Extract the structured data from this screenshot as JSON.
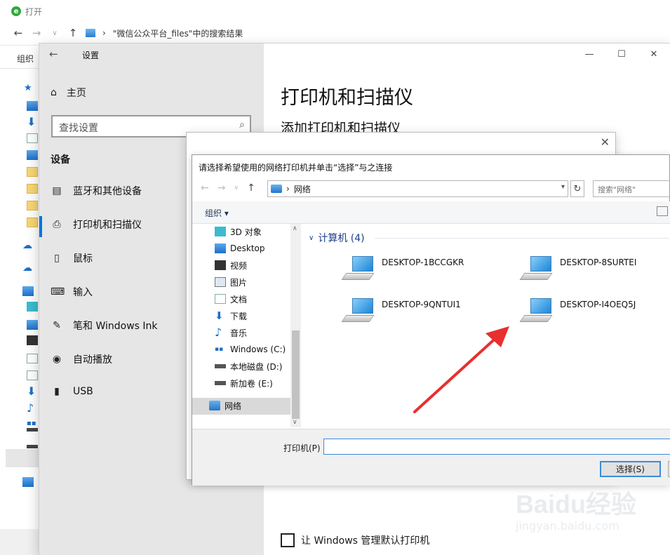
{
  "background_window": {
    "title": "打开",
    "path": "\"微信公众平台_files\"中的搜索结果",
    "ribbon_label": "组织"
  },
  "settings": {
    "window_title": "设置",
    "home_label": "主页",
    "search_placeholder": "查找设置",
    "group_title": "设备",
    "items": [
      {
        "label": "蓝牙和其他设备",
        "icon": "bluetooth-devices-icon"
      },
      {
        "label": "打印机和扫描仪",
        "icon": "printer-icon",
        "selected": true
      },
      {
        "label": "鼠标",
        "icon": "mouse-icon"
      },
      {
        "label": "输入",
        "icon": "keyboard-icon"
      },
      {
        "label": "笔和 Windows Ink",
        "icon": "pen-icon"
      },
      {
        "label": "自动播放",
        "icon": "autoplay-icon"
      },
      {
        "label": "USB",
        "icon": "usb-icon"
      }
    ],
    "main_title": "打印机和扫描仪",
    "main_subtitle": "添加打印机和扫描仪",
    "checkbox_label": "让 Windows 管理默认打印机",
    "checkbox_checked": false
  },
  "dialog": {
    "title": "请选择希望使用的网络打印机并单击“选择”与之连接",
    "path_label": "网络",
    "search_placeholder": "搜索\"网络\"",
    "organize_label": "组织 ▾",
    "tree": [
      {
        "label": "3D 对象",
        "icon": "3d-objects-icon"
      },
      {
        "label": "Desktop",
        "icon": "desktop-icon"
      },
      {
        "label": "视频",
        "icon": "video-icon"
      },
      {
        "label": "图片",
        "icon": "pictures-icon"
      },
      {
        "label": "文档",
        "icon": "documents-icon"
      },
      {
        "label": "下载",
        "icon": "downloads-icon"
      },
      {
        "label": "音乐",
        "icon": "music-icon"
      },
      {
        "label": "Windows (C:)",
        "icon": "windows-drive-icon"
      },
      {
        "label": "本地磁盘 (D:)",
        "icon": "drive-icon"
      },
      {
        "label": "新加卷 (E:)",
        "icon": "drive-icon"
      },
      {
        "label": "网络",
        "icon": "network-icon",
        "selected": true
      }
    ],
    "group_header": "计算机 (4)",
    "computers": [
      "DESKTOP-1BCCGKR",
      "DESKTOP-8SURTEI",
      "DESKTOP-9QNTUI1",
      "DESKTOP-I4OEQ5J"
    ],
    "printer_label": "打印机(P)",
    "printer_value": "",
    "select_button": "选择(S)",
    "annotation_arrow_color": "#e8302f"
  },
  "watermark": {
    "brand": "Baidu经验",
    "url": "jingyan.baidu.com"
  }
}
